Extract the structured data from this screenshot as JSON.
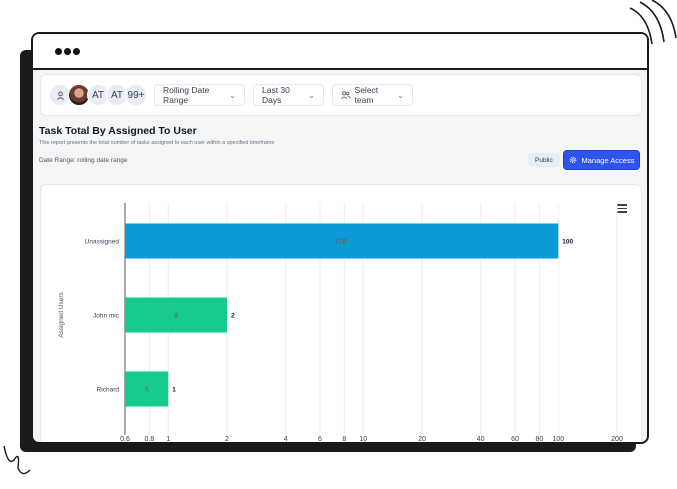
{
  "toolbar": {
    "avatars": [
      {
        "icon": "user-icon"
      },
      {
        "icon": "profile-photo"
      },
      {
        "label": "AT"
      },
      {
        "label": "AT"
      },
      {
        "label": "99+"
      }
    ],
    "date_range_select": "Rolling Date Range",
    "period_select": "Last 30 Days",
    "team_select": "Select team"
  },
  "report": {
    "title": "Task Total By Assigned To User",
    "description": "This report presents the total number of tasks assigned to each user within a specified timeframe",
    "date_range": "Date Range: rolling date range",
    "visibility_badge": "Public",
    "manage_access_label": "Manage Access"
  },
  "colors": {
    "bar_unassigned": "#0b9bd6",
    "bar_users": "#16c98d",
    "accent_button": "#2f54eb"
  },
  "chart_data": {
    "type": "bar",
    "orientation": "horizontal",
    "ylabel": "Assigned Users",
    "xscale": "log",
    "xlim": [
      0.6,
      200
    ],
    "xticks": [
      0.6,
      0.8,
      1,
      2,
      4,
      6,
      8,
      10,
      20,
      40,
      60,
      80,
      100,
      200
    ],
    "xtick_labels": [
      "0.6",
      "0.8",
      "1",
      "2",
      "4",
      "6",
      "8",
      "10",
      "20",
      "40",
      "60",
      "80",
      "100",
      "200"
    ],
    "categories": [
      "Unassigned",
      "John mic",
      "Richard"
    ],
    "values": [
      100,
      2,
      1
    ],
    "grid": true
  }
}
